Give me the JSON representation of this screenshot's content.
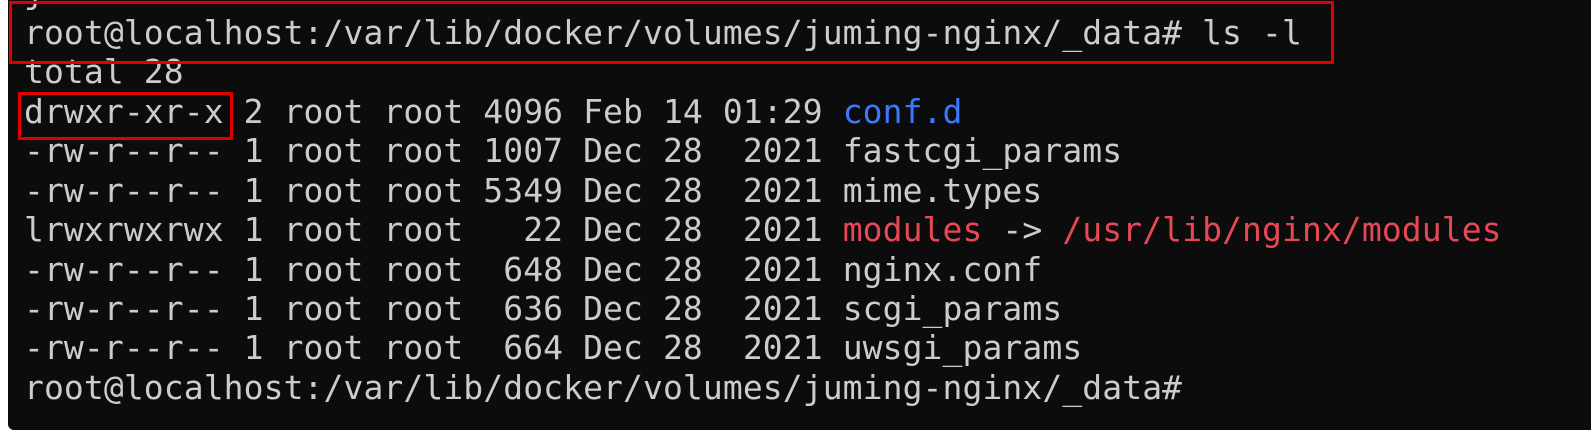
{
  "terminal": {
    "partial_top": "j",
    "command_prompt": "root@localhost:/var/lib/docker/volumes/juming-nginx/_data#",
    "command": " ls -l",
    "total": "total 28",
    "entries": [
      {
        "meta": "drwxr-xr-x 2 root root 4096 Feb 14 01:29 ",
        "name": "conf.d",
        "kind": "dir",
        "arrow": "",
        "target": ""
      },
      {
        "meta": "-rw-r--r-- 1 root root 1007 Dec 28  2021 ",
        "name": "fastcgi_params",
        "kind": "file",
        "arrow": "",
        "target": ""
      },
      {
        "meta": "-rw-r--r-- 1 root root 5349 Dec 28  2021 ",
        "name": "mime.types",
        "kind": "file",
        "arrow": "",
        "target": ""
      },
      {
        "meta": "lrwxrwxrwx 1 root root   22 Dec 28  2021 ",
        "name": "modules",
        "kind": "link",
        "arrow": " -> ",
        "target": "/usr/lib/nginx/modules"
      },
      {
        "meta": "-rw-r--r-- 1 root root  648 Dec 28  2021 ",
        "name": "nginx.conf",
        "kind": "file",
        "arrow": "",
        "target": ""
      },
      {
        "meta": "-rw-r--r-- 1 root root  636 Dec 28  2021 ",
        "name": "scgi_params",
        "kind": "file",
        "arrow": "",
        "target": ""
      },
      {
        "meta": "-rw-r--r-- 1 root root  664 Dec 28  2021 ",
        "name": "uwsgi_params",
        "kind": "file",
        "arrow": "",
        "target": ""
      }
    ],
    "final_prompt": "root@localhost:/var/lib/docker/volumes/juming-nginx/_data#"
  },
  "colors": {
    "background": "#0c0c0c",
    "text": "#cccccc",
    "directory": "#3b78ff",
    "symlink": "#e74856",
    "highlight_border": "#e00000"
  }
}
